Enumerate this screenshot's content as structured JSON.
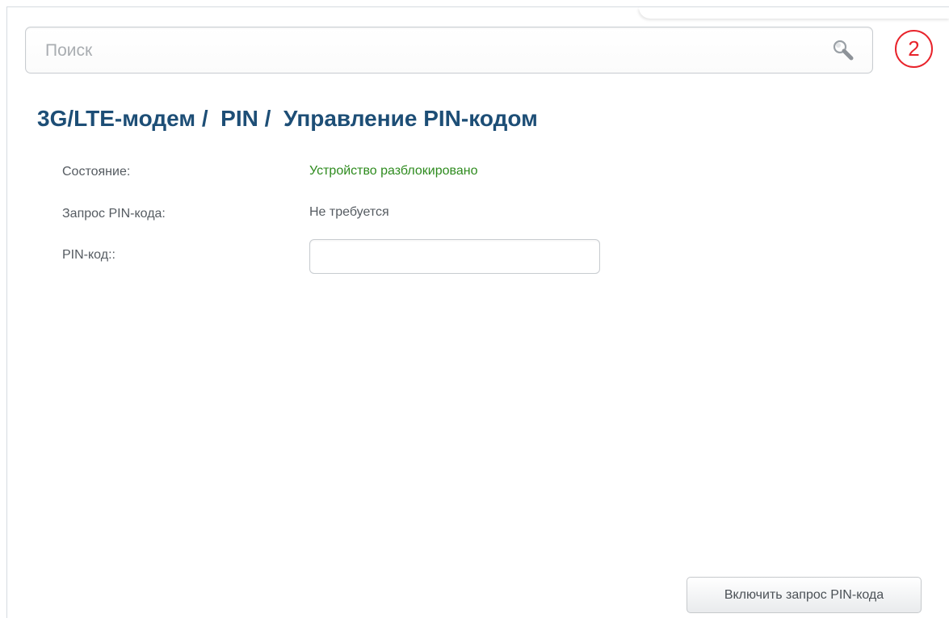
{
  "search": {
    "placeholder": "Поиск",
    "icon": "search-icon"
  },
  "notifications": {
    "count": "2",
    "color": "#e8232b"
  },
  "breadcrumb": {
    "section": "3G/LTE-модем",
    "separator": "/",
    "subsection": "PIN",
    "page": "Управление PIN-кодом",
    "color": "#1d4e76"
  },
  "status": {
    "label": "Состояние:",
    "value": "Устройство разблокировано",
    "value_color": "#2e8b1e"
  },
  "pin_request": {
    "label": "Запрос PIN-кода:",
    "value": "Не требуется"
  },
  "pin_code": {
    "label": "PIN-код::",
    "value": ""
  },
  "actions": {
    "enable_pin_request": "Включить запрос PIN-кода"
  }
}
